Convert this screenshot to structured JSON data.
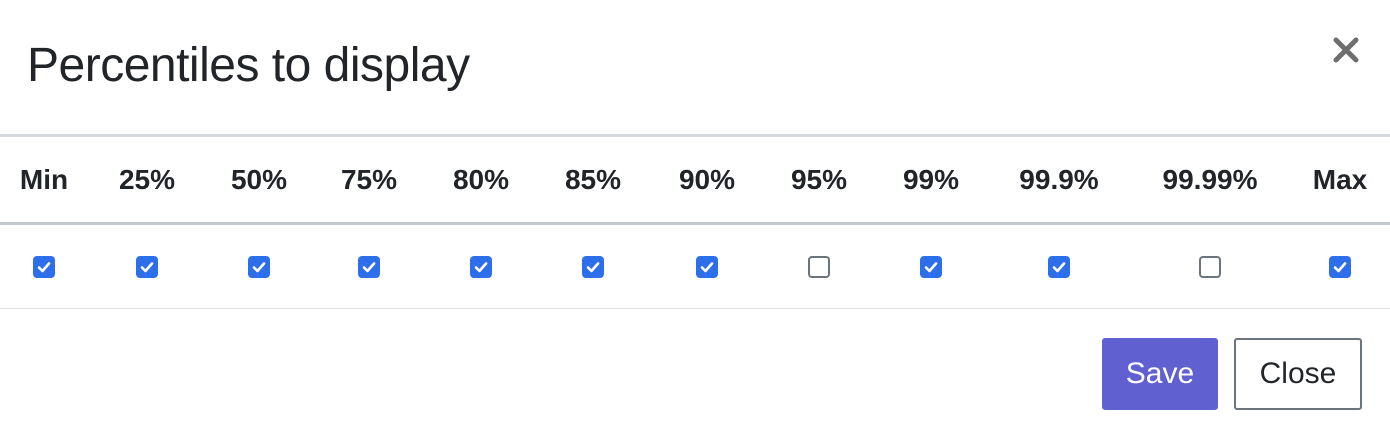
{
  "dialog": {
    "title": "Percentiles to display",
    "close_icon": "close-icon"
  },
  "percentiles": [
    {
      "label": "Min",
      "checked": true
    },
    {
      "label": "25%",
      "checked": true
    },
    {
      "label": "50%",
      "checked": true
    },
    {
      "label": "75%",
      "checked": true
    },
    {
      "label": "80%",
      "checked": true
    },
    {
      "label": "85%",
      "checked": true
    },
    {
      "label": "90%",
      "checked": true
    },
    {
      "label": "95%",
      "checked": false
    },
    {
      "label": "99%",
      "checked": true
    },
    {
      "label": "99.9%",
      "checked": true
    },
    {
      "label": "99.99%",
      "checked": false
    },
    {
      "label": "Max",
      "checked": true
    }
  ],
  "footer": {
    "save_label": "Save",
    "close_label": "Close"
  },
  "colors": {
    "checkbox_checked": "#2d6fea",
    "save_button": "#6060d0"
  }
}
